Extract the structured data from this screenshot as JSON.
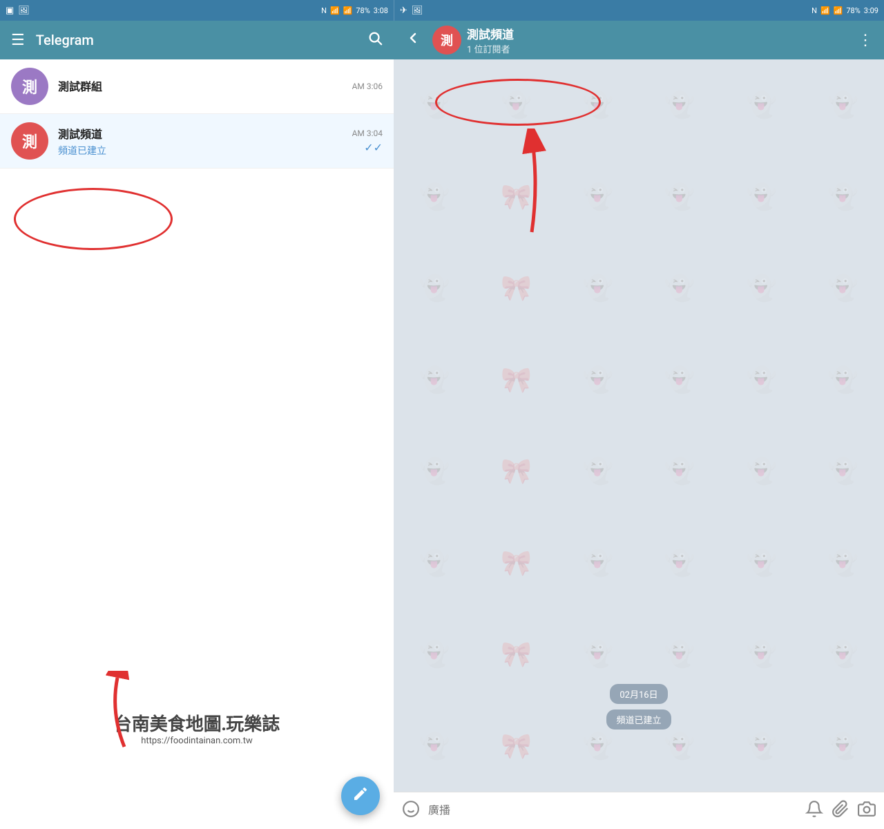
{
  "statusBar": {
    "left": {
      "battery": "78%",
      "time": "3:08",
      "signal": "▂▄▆",
      "wifi": "wifi",
      "nfc": "N"
    },
    "right": {
      "battery": "78%",
      "time": "3:09",
      "signal": "▂▄▆",
      "wifi": "wifi",
      "nfc": "N"
    }
  },
  "leftPanel": {
    "toolbar": {
      "title": "Telegram",
      "menuIcon": "☰",
      "searchIcon": "🔍"
    },
    "chatList": [
      {
        "id": "group",
        "avatarText": "測",
        "avatarColor": "purple",
        "name": "測試群組",
        "preview": "",
        "time": "AM 3:06",
        "check": ""
      },
      {
        "id": "channel",
        "avatarText": "測",
        "avatarColor": "red",
        "name": "測試頻道",
        "preview": "頻道已建立",
        "time": "AM 3:04",
        "check": "✓✓"
      }
    ],
    "fab": {
      "icon": "✎"
    }
  },
  "rightPanel": {
    "toolbar": {
      "backIcon": "←",
      "avatarText": "測",
      "channelName": "測試頻道",
      "subscribers": "1 位訂閱者",
      "moreIcon": "⋮"
    },
    "dateBadge": "02月16日",
    "createdBadge": "頻道已建立",
    "bottomBar": {
      "emojiIcon": "😊",
      "placeholder": "廣播",
      "notifyIcon": "🔔",
      "attachIcon": "📎",
      "cameraIcon": "📷"
    }
  },
  "watermark": {
    "chinese": "台南美食地圖.玩樂誌",
    "url": "https://foodintainan.com.tw"
  },
  "patterns": [
    "👻",
    "👻",
    "👻",
    "👻",
    "👻",
    "👻",
    "👻",
    "👻",
    "👻",
    "👻",
    "👻",
    "👻",
    "👻",
    "👻",
    "👻",
    "👻",
    "👻",
    "👻",
    "👻",
    "👻",
    "👻",
    "👻",
    "👻",
    "👻",
    "👻",
    "👻",
    "👻",
    "👻",
    "👻",
    "👻",
    "👻",
    "👻",
    "👻",
    "👻",
    "👻",
    "👻",
    "👻",
    "👻",
    "👻",
    "👻",
    "👻",
    "👻",
    "👻",
    "👻",
    "👻",
    "👻",
    "👻",
    "👻"
  ]
}
